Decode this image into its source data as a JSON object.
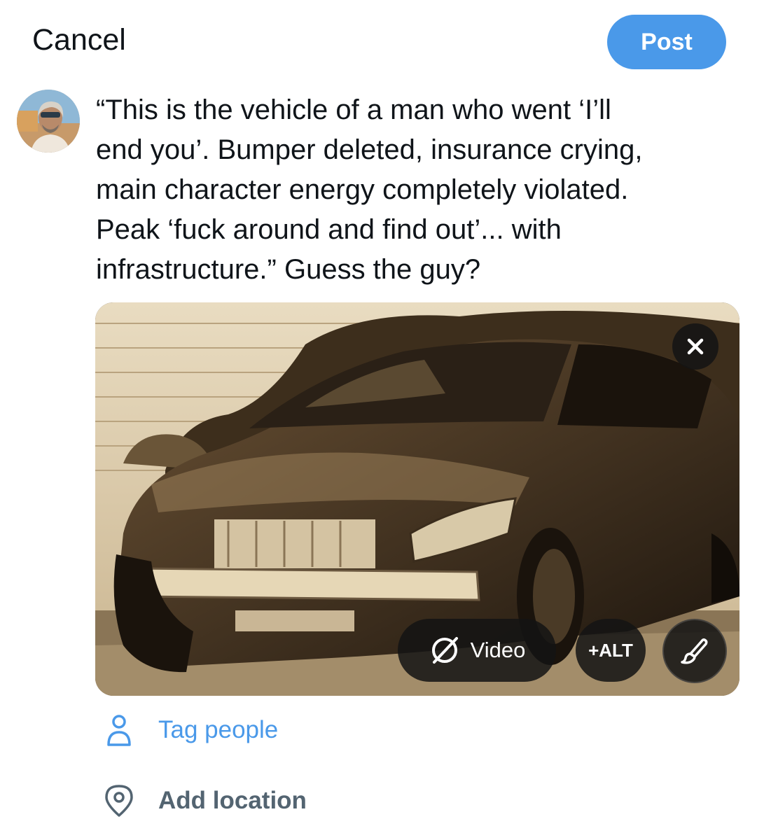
{
  "header": {
    "cancel_label": "Cancel",
    "post_label": "Post"
  },
  "colors": {
    "accent": "#4a99e9",
    "text": "#0f1419",
    "secondary": "#536471"
  },
  "composer": {
    "avatar_icon": "user-avatar",
    "text": "“This is the vehicle of a man who went ‘I’ll\nend you’. Bumper deleted, insurance crying,\nmain character energy completely violated.\nPeak ‘fuck around and find out’... with\ninfrastructure.” Guess the guy?"
  },
  "media": {
    "close_icon": "close-icon",
    "video_label": "Video",
    "alt_label": "+ALT",
    "edit_icon": "brush-icon"
  },
  "actions": {
    "tag_label": "Tag people",
    "tag_icon": "person-icon",
    "location_label": "Add location",
    "location_icon": "location-pin-icon"
  }
}
